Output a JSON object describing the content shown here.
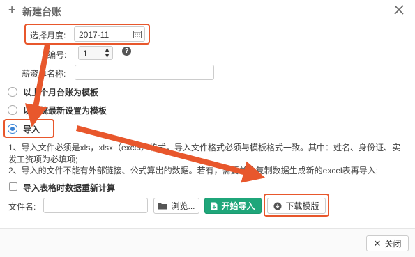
{
  "dialog": {
    "title": "新建台账",
    "close_icon": "close-icon"
  },
  "form": {
    "month_label": "选择月度:",
    "month_value": "2017-11",
    "number_label": "编号:",
    "number_value": "1",
    "salary_label": "薪资单名称:",
    "salary_value": ""
  },
  "options": {
    "last_month": "以上个月台账为模板",
    "latest_settings": "以系统最新设置为模板",
    "import": "导入"
  },
  "notes": {
    "line1": "1、导入文件必须是xls，xlsx（excel）格式，导入文件格式必须与模板格式一致。其中：姓名、身份证、实",
    "line2": "发工资项为必填项;",
    "line3": "2、导入的文件不能有外部链接、公式算出的数据。若有，需要单独复制数据生成新的excel表再导入;"
  },
  "recalc": {
    "label": "导入表格时数据重新计算"
  },
  "file": {
    "label": "文件名:",
    "value": "",
    "browse": "浏览...",
    "start_import": "开始导入",
    "download_template": "下载模版"
  },
  "footer": {
    "close": "关闭"
  },
  "colors": {
    "highlight": "#e8572c",
    "accent_green": "#1fa67a",
    "radio_blue": "#3a84d6"
  }
}
